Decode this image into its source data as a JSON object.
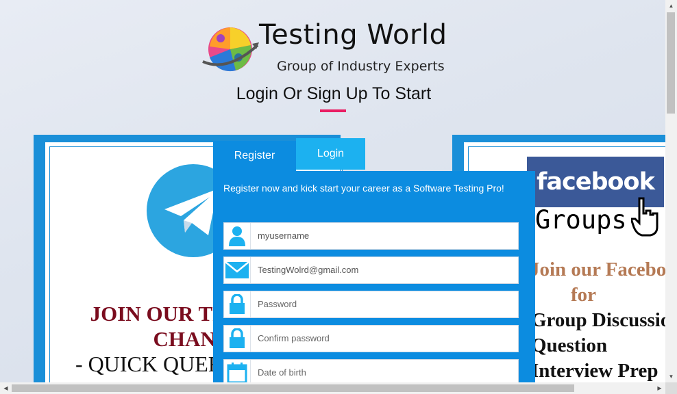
{
  "header": {
    "brand_title": "Testing World",
    "brand_subtitle": "Group of Industry Experts",
    "heading": "Login Or Sign Up To Start"
  },
  "left_panel": {
    "line1": "JOIN OUR TELEGRAM",
    "line2": "CHANNEL",
    "line3": "- QUICK QUERIES"
  },
  "right_panel": {
    "banner": "facebook",
    "groups": "Groups",
    "line1": "Join our Facebook",
    "line2": "for",
    "line3": "Group Discussion",
    "line4": "Question",
    "line5": "Interview Prep"
  },
  "tabs": {
    "register": "Register",
    "login": "Login"
  },
  "form": {
    "intro": "Register now and kick start your career as a Software Testing Pro!",
    "fields": [
      {
        "icon": "user-icon",
        "value": "myusername"
      },
      {
        "icon": "envelope-icon",
        "value": "TestingWolrd@gmail.com"
      },
      {
        "icon": "lock-icon",
        "value": "Password"
      },
      {
        "icon": "lock-icon",
        "value": "Confirm password"
      },
      {
        "icon": "calendar-icon",
        "value": "Date of birth"
      }
    ]
  },
  "colors": {
    "primary": "#0c8ce0",
    "tab_active": "#1cb1f0",
    "accent": "#e91e63",
    "icon_blue": "#1cb1f0",
    "facebook": "#3b5998"
  }
}
